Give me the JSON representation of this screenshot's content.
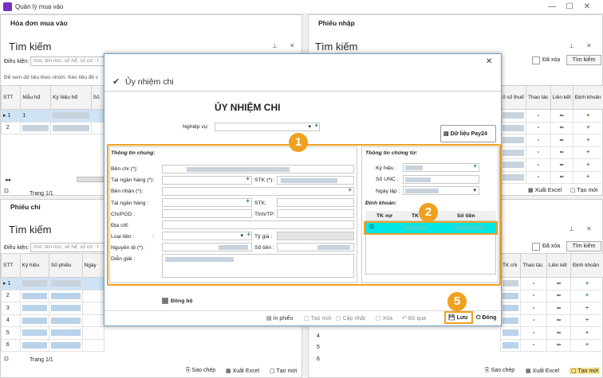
{
  "window": {
    "title": "Quản lý mua vào"
  },
  "top_left": {
    "title": "Hóa đơn mua vào",
    "search_title": "Tìm kiếm",
    "cond_label": "Điều kiện:",
    "cond_placeholder": "mst, tên ncc, số hđ, số cứ : t",
    "group_hint": "Để xem dữ liệu theo nhóm: Kéo tiêu đề c",
    "cols": [
      "STT",
      "Mẫu hđ",
      "Ký hiệu hđ",
      "Số"
    ],
    "rows": [
      [
        "1",
        "1"
      ],
      [
        "2",
        ""
      ]
    ],
    "page": "Trang 1/1"
  },
  "top_right": {
    "title": "Phiếu nhập",
    "search_title": "Tìm kiếm",
    "deleted_label": "Đã xóa",
    "search_button": "Tìm kiếm",
    "cols": [
      "ố số thuế",
      "Thao tác",
      "Liên kết",
      "Định khoản"
    ],
    "row_count": 6,
    "export": "Xuất Excel",
    "create": "Tạo mới"
  },
  "bottom_left": {
    "title": "Phiếu chi",
    "search_title": "Tìm kiếm",
    "cond_label": "Điều kiện:",
    "cond_placeholder": "mst, tên ncc, số hđ, số cứ : t",
    "cols": [
      "STT",
      "Ký hiệu",
      "Số phiếu",
      "Ngày"
    ],
    "rows": [
      "1",
      "2",
      "3",
      "4",
      "5",
      "6"
    ],
    "page": "Trang 1/1",
    "copy": "Sao chép",
    "export": "Xuất Excel",
    "create": "Tạo mới"
  },
  "bottom_right": {
    "deleted_label": "Đã xóa",
    "search_button": "Tìm kiếm",
    "cols": [
      "TK chi",
      "Thao tác",
      "Liên kết",
      "Định khoản"
    ],
    "rows": [
      "4",
      "5",
      "6"
    ],
    "copy": "Sao chép",
    "export": "Xuất Excel",
    "create": "Tạo mới"
  },
  "modal": {
    "title": "Ủy nhiệm chi",
    "heading": "ỦY NHIỆM CHI",
    "nghiep_vu": "Nghiệp vụ:",
    "pay24": "Dữ liệu Pay24",
    "general_title": "Thông tin chung:",
    "ben_chi": "Bên chi (*):",
    "tai_ngan_hang": "Tại ngân hàng (*):",
    "stk_req": "STK (*):",
    "ben_nhan": "Bên nhận (*):",
    "tai_ngan_hang2": "Tại ngân hàng :",
    "stk": "STK:",
    "cn_pgd": "CN/PGD :",
    "tinh_tp": "Tỉnh/TP:",
    "dia_chi": "Địa chỉ:",
    "loai_tien": "Loại tiền :",
    "ty_gia": "Tỷ giá :",
    "nguyen_te": "Nguyên tệ (*):",
    "so_tien": "Số tiền :",
    "dien_giai": "Diễn giải :",
    "voucher_title": "Thông tin chứng từ:",
    "ky_hieu": "Ký hiệu :",
    "so_unc": "Số UNC :",
    "ngay_lap": "Ngày lập :",
    "dinh_khoan": "Định khoản:",
    "dk_cols": [
      "TK nợ",
      "TK có",
      "Số tiền"
    ],
    "dong_bo": "Đồng bộ",
    "in_phieu": "In phiếu",
    "tao_moi": "Tạo mới",
    "cap_nhat": "Cập nhật",
    "xoa": "Xóa",
    "bo_qua": "Bỏ qua",
    "luu": "Lưu",
    "dong": "Đóng"
  },
  "badges": [
    "1",
    "2",
    "5"
  ],
  "colors": {
    "accent": "#f0a020",
    "cyan": "#00e5e5",
    "header_blue": "#6fa0cc"
  }
}
